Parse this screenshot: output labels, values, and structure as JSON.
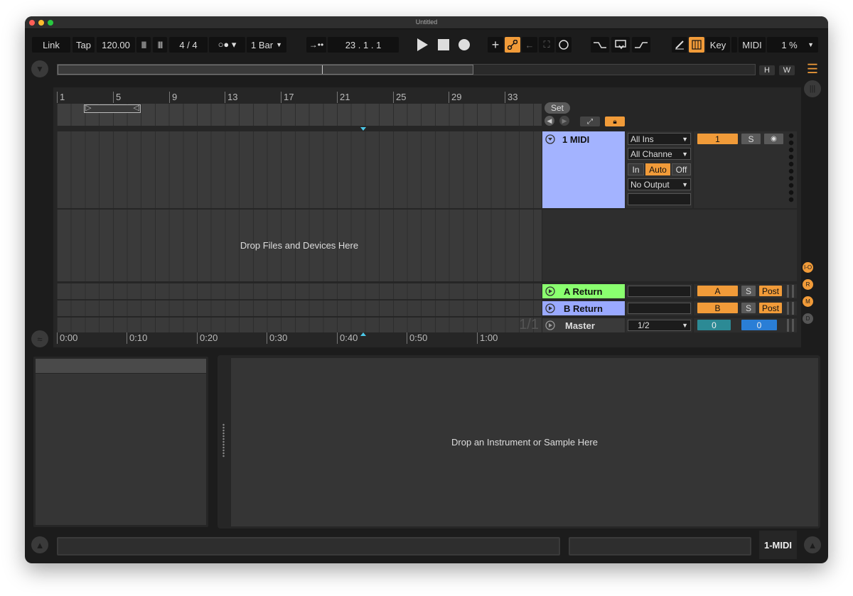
{
  "window": {
    "title": "Untitled"
  },
  "transport": {
    "link": "Link",
    "tap": "Tap",
    "tempo": "120.00",
    "signature": "4 / 4",
    "quantization": "1 Bar",
    "position": "23 .  1 .  1",
    "key": "Key",
    "midi": "MIDI",
    "cpu": "1 %"
  },
  "overview": {
    "h_label": "H",
    "w_label": "W"
  },
  "ruler": {
    "bars": [
      "1",
      "5",
      "9",
      "13",
      "17",
      "21",
      "25",
      "29",
      "33"
    ]
  },
  "timeline": {
    "times": [
      "0:00",
      "0:10",
      "0:20",
      "0:30",
      "0:40",
      "0:50",
      "1:00"
    ]
  },
  "arrangement": {
    "set_label": "Set",
    "drop_hint": "Drop Files and Devices Here",
    "loop_count": "1/1"
  },
  "tracks": [
    {
      "name": "1 MIDI",
      "input_type": "All Ins",
      "input_channel": "All Channe",
      "monitor": [
        "In",
        "Auto",
        "Off"
      ],
      "monitor_active": "Auto",
      "output": "No Output",
      "number": "1",
      "solo": "S"
    },
    {
      "name": "A Return",
      "send_badge": "A",
      "solo": "S",
      "post": "Post"
    },
    {
      "name": "B Return",
      "send_badge": "B",
      "solo": "S",
      "post": "Post"
    },
    {
      "name": "Master",
      "cue_out": "1/2",
      "master_vol": "0",
      "cue_vol": "0"
    }
  ],
  "right_side": {
    "io": "I-O",
    "r": "R",
    "m": "M",
    "d": "D"
  },
  "detail": {
    "instrument_hint": "Drop an Instrument or Sample Here"
  },
  "statusbar": {
    "selected_track": "1-MIDI"
  },
  "colors": {
    "accent": "#f19b39",
    "midi_track": "#a3b3ff",
    "a_return": "#8aff6f",
    "b_return": "#9aa9ff",
    "panel": "#262626"
  }
}
